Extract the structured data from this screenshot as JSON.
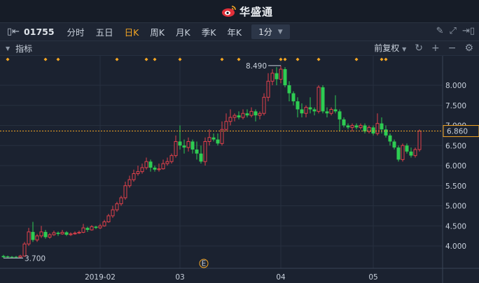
{
  "app": {
    "brand": "华盛通"
  },
  "toolbar": {
    "code": "01755",
    "tabs": [
      {
        "label": "分时",
        "active": false
      },
      {
        "label": "五日",
        "active": false
      },
      {
        "label": "日K",
        "active": true
      },
      {
        "label": "周K",
        "active": false
      },
      {
        "label": "月K",
        "active": false
      },
      {
        "label": "季K",
        "active": false
      },
      {
        "label": "年K",
        "active": false
      }
    ],
    "period_value": "1分"
  },
  "indicator_bar": {
    "label": "指标",
    "adjust_label": "前复权"
  },
  "colors": {
    "up": "#e0404a",
    "down": "#2ecc52",
    "accent": "#f5a623",
    "background": "#1b2230"
  },
  "chart_data": {
    "type": "candlestick",
    "ylim": [
      3.6,
      8.8
    ],
    "y_ticks": [
      "8.000",
      "7.500",
      "7.000",
      "6.500",
      "6.000",
      "5.500",
      "5.000",
      "4.500",
      "4.000"
    ],
    "x_ticks": [
      {
        "label": "2019-02",
        "index": 23
      },
      {
        "label": "03",
        "index": 42
      },
      {
        "label": "04",
        "index": 66
      },
      {
        "label": "05",
        "index": 88
      }
    ],
    "last_price": "6.860",
    "max_label": "8.490",
    "min_label": "3.700",
    "event_marker": "E",
    "candles": [
      [
        3.75,
        3.72,
        3.78,
        3.7
      ],
      [
        3.74,
        3.72,
        3.76,
        3.7
      ],
      [
        3.73,
        3.72,
        3.75,
        3.7
      ],
      [
        3.73,
        3.72,
        3.75,
        3.7
      ],
      [
        3.72,
        3.75,
        3.78,
        3.7
      ],
      [
        3.75,
        4.05,
        4.1,
        3.73
      ],
      [
        4.05,
        4.35,
        4.45,
        4.0
      ],
      [
        4.35,
        4.15,
        4.6,
        4.1
      ],
      [
        4.15,
        4.25,
        4.3,
        4.1
      ],
      [
        4.25,
        4.35,
        4.5,
        4.2
      ],
      [
        4.35,
        4.22,
        4.4,
        4.18
      ],
      [
        4.22,
        4.28,
        4.32,
        4.18
      ],
      [
        4.28,
        4.33,
        4.38,
        4.25
      ],
      [
        4.33,
        4.3,
        4.36,
        4.25
      ],
      [
        4.3,
        4.34,
        4.4,
        4.28
      ],
      [
        4.34,
        4.28,
        4.37,
        4.25
      ],
      [
        4.28,
        4.3,
        4.34,
        4.25
      ],
      [
        4.3,
        4.32,
        4.36,
        4.28
      ],
      [
        4.32,
        4.34,
        4.38,
        4.3
      ],
      [
        4.34,
        4.45,
        4.55,
        4.32
      ],
      [
        4.45,
        4.4,
        4.48,
        4.35
      ],
      [
        4.4,
        4.48,
        4.52,
        4.38
      ],
      [
        4.48,
        4.45,
        4.5,
        4.42
      ],
      [
        4.45,
        4.5,
        4.55,
        4.42
      ],
      [
        4.5,
        4.6,
        4.65,
        4.48
      ],
      [
        4.6,
        4.75,
        4.8,
        4.58
      ],
      [
        4.75,
        4.9,
        5.0,
        4.7
      ],
      [
        4.9,
        5.05,
        5.1,
        4.85
      ],
      [
        5.05,
        5.2,
        5.25,
        5.0
      ],
      [
        5.2,
        5.5,
        5.6,
        5.15
      ],
      [
        5.5,
        5.65,
        5.75,
        5.45
      ],
      [
        5.65,
        5.8,
        5.9,
        5.6
      ],
      [
        5.8,
        5.85,
        6.0,
        5.75
      ],
      [
        5.85,
        5.95,
        6.05,
        5.8
      ],
      [
        5.95,
        6.1,
        6.2,
        5.9
      ],
      [
        6.1,
        5.95,
        6.15,
        5.85
      ],
      [
        5.95,
        5.9,
        6.0,
        5.85
      ],
      [
        5.9,
        5.92,
        6.05,
        5.85
      ],
      [
        5.92,
        6.05,
        6.15,
        5.9
      ],
      [
        6.05,
        6.1,
        6.2,
        6.0
      ],
      [
        6.1,
        6.25,
        6.3,
        6.05
      ],
      [
        6.25,
        6.6,
        6.75,
        6.2
      ],
      [
        6.6,
        6.5,
        7.0,
        6.4
      ],
      [
        6.5,
        6.45,
        6.65,
        6.3
      ],
      [
        6.45,
        6.6,
        6.7,
        6.35
      ],
      [
        6.6,
        6.4,
        6.65,
        6.3
      ],
      [
        6.4,
        6.3,
        6.6,
        6.15
      ],
      [
        6.3,
        6.1,
        6.5,
        6.05
      ],
      [
        6.1,
        6.6,
        6.7,
        6.0
      ],
      [
        6.6,
        6.7,
        6.9,
        6.5
      ],
      [
        6.7,
        6.65,
        6.8,
        6.6
      ],
      [
        6.65,
        6.55,
        6.8,
        6.5
      ],
      [
        6.55,
        6.9,
        7.1,
        6.5
      ],
      [
        6.9,
        7.1,
        7.3,
        6.85
      ],
      [
        7.1,
        7.2,
        7.4,
        7.0
      ],
      [
        7.2,
        7.25,
        7.3,
        7.1
      ],
      [
        7.25,
        7.2,
        7.35,
        7.15
      ],
      [
        7.2,
        7.3,
        7.4,
        7.15
      ],
      [
        7.3,
        7.25,
        7.4,
        7.2
      ],
      [
        7.25,
        7.35,
        7.45,
        7.2
      ],
      [
        7.35,
        7.25,
        7.4,
        7.1
      ],
      [
        7.25,
        7.3,
        7.35,
        7.15
      ],
      [
        7.3,
        7.7,
        7.8,
        7.25
      ],
      [
        7.7,
        8.1,
        8.3,
        7.6
      ],
      [
        8.1,
        8.3,
        8.4,
        8.0
      ],
      [
        8.3,
        8.15,
        8.45,
        8.0
      ],
      [
        8.15,
        8.4,
        8.49,
        8.05
      ],
      [
        8.4,
        8.0,
        8.45,
        7.95
      ],
      [
        8.0,
        7.8,
        8.1,
        7.6
      ],
      [
        7.8,
        7.6,
        7.85,
        7.5
      ],
      [
        7.6,
        7.4,
        7.7,
        7.2
      ],
      [
        7.4,
        7.3,
        7.55,
        7.2
      ],
      [
        7.3,
        7.45,
        7.5,
        7.2
      ],
      [
        7.45,
        7.4,
        7.7,
        7.3
      ],
      [
        7.4,
        7.35,
        7.45,
        7.25
      ],
      [
        7.35,
        7.95,
        8.0,
        7.3
      ],
      [
        7.95,
        7.35,
        8.0,
        7.3
      ],
      [
        7.35,
        7.3,
        7.45,
        7.2
      ],
      [
        7.3,
        7.4,
        7.45,
        7.25
      ],
      [
        7.4,
        7.35,
        7.75,
        7.3
      ],
      [
        7.35,
        7.15,
        7.4,
        6.85
      ],
      [
        7.15,
        7.0,
        7.2,
        6.95
      ],
      [
        7.0,
        6.95,
        7.05,
        6.9
      ],
      [
        6.95,
        7.0,
        7.05,
        6.85
      ],
      [
        7.0,
        6.95,
        7.05,
        6.9
      ],
      [
        6.95,
        7.0,
        7.05,
        6.9
      ],
      [
        7.0,
        6.85,
        7.05,
        6.8
      ],
      [
        6.85,
        6.95,
        7.0,
        6.8
      ],
      [
        6.95,
        6.8,
        7.0,
        6.75
      ],
      [
        6.8,
        7.05,
        7.3,
        6.75
      ],
      [
        7.05,
        6.9,
        7.2,
        6.8
      ],
      [
        6.9,
        6.75,
        7.0,
        6.7
      ],
      [
        6.75,
        6.6,
        6.8,
        6.5
      ],
      [
        6.6,
        6.45,
        6.65,
        6.4
      ],
      [
        6.45,
        6.15,
        6.5,
        6.1
      ],
      [
        6.15,
        6.5,
        6.55,
        6.1
      ],
      [
        6.5,
        6.35,
        6.55,
        6.3
      ],
      [
        6.35,
        6.25,
        6.45,
        6.2
      ],
      [
        6.25,
        6.4,
        6.45,
        6.2
      ],
      [
        6.4,
        6.86,
        6.9,
        6.35
      ]
    ]
  }
}
